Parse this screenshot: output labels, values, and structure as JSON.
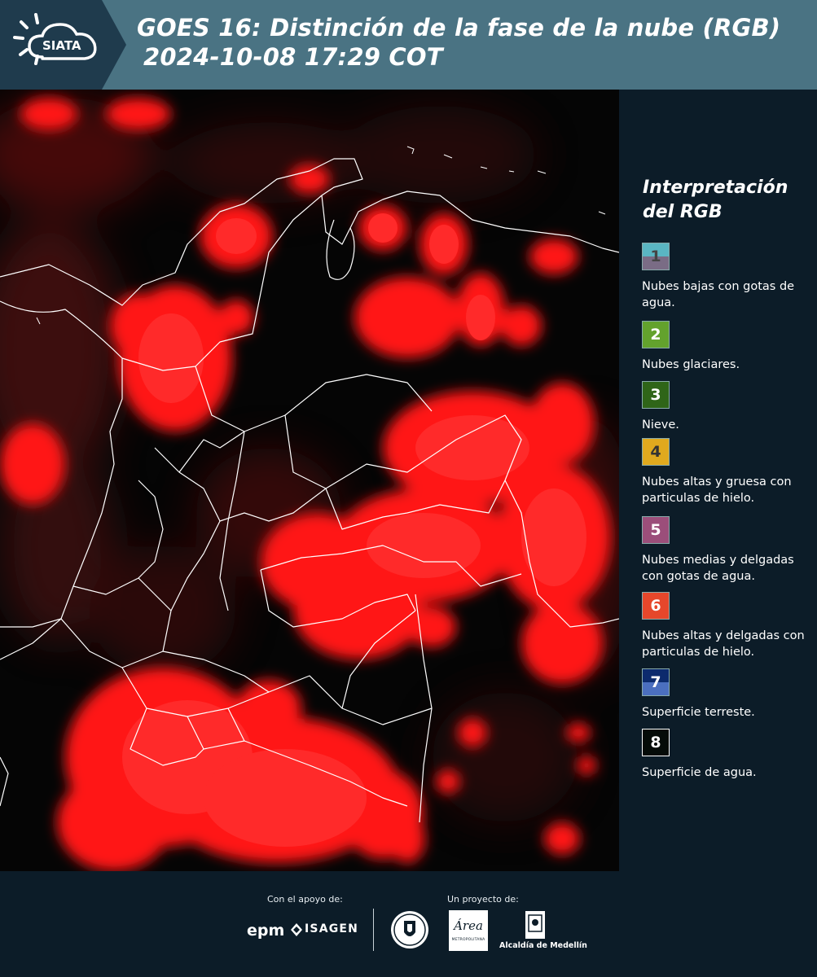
{
  "header": {
    "logo_text": "SIATA",
    "title_line1": "GOES 16: Distinción de la fase de la nube (RGB)",
    "title_line2": "2024-10-08 17:29 COT",
    "background_color": "#4a7383",
    "logo_band_color": "#1f3b4d"
  },
  "legend": {
    "title": "Interpretación del RGB",
    "items": [
      {
        "number": "1",
        "label": "Nubes bajas con gotas de agua.",
        "colors": [
          "#5ab6c3",
          "#7a6c85"
        ]
      },
      {
        "number": "2",
        "label": "Nubes glaciares.",
        "colors": [
          "#63a22d"
        ]
      },
      {
        "number": "3",
        "label": "Nieve.",
        "colors": [
          "#2f6518"
        ]
      },
      {
        "number": "4",
        "label": "Nubes altas y gruesa con particulas de hielo.",
        "colors": [
          "#e0a91e"
        ]
      },
      {
        "number": "5",
        "label": "Nubes medias y delgadas con gotas de agua.",
        "colors": [
          "#9b4e7a"
        ]
      },
      {
        "number": "6",
        "label": "Nubes altas y delgadas con particulas de hielo.",
        "colors": [
          "#e6472b"
        ]
      },
      {
        "number": "7",
        "label": "Superficie terreste.",
        "colors": [
          "#0c2a6d",
          "#4b6fbf"
        ]
      },
      {
        "number": "8",
        "label": "Superficie de agua.",
        "colors": [
          "#050b08"
        ]
      }
    ]
  },
  "footer": {
    "support_label": "Con el apoyo de:",
    "project_label": "Un proyecto de:",
    "epm": "epm",
    "isagen": "ISAGEN",
    "area_text": "Área",
    "area_sub": "METROPOLITANA",
    "alcaldia": "Alcaldía de Medellín"
  },
  "map": {
    "cloud_color": "#ff1414",
    "border_color": "#ffffff"
  }
}
